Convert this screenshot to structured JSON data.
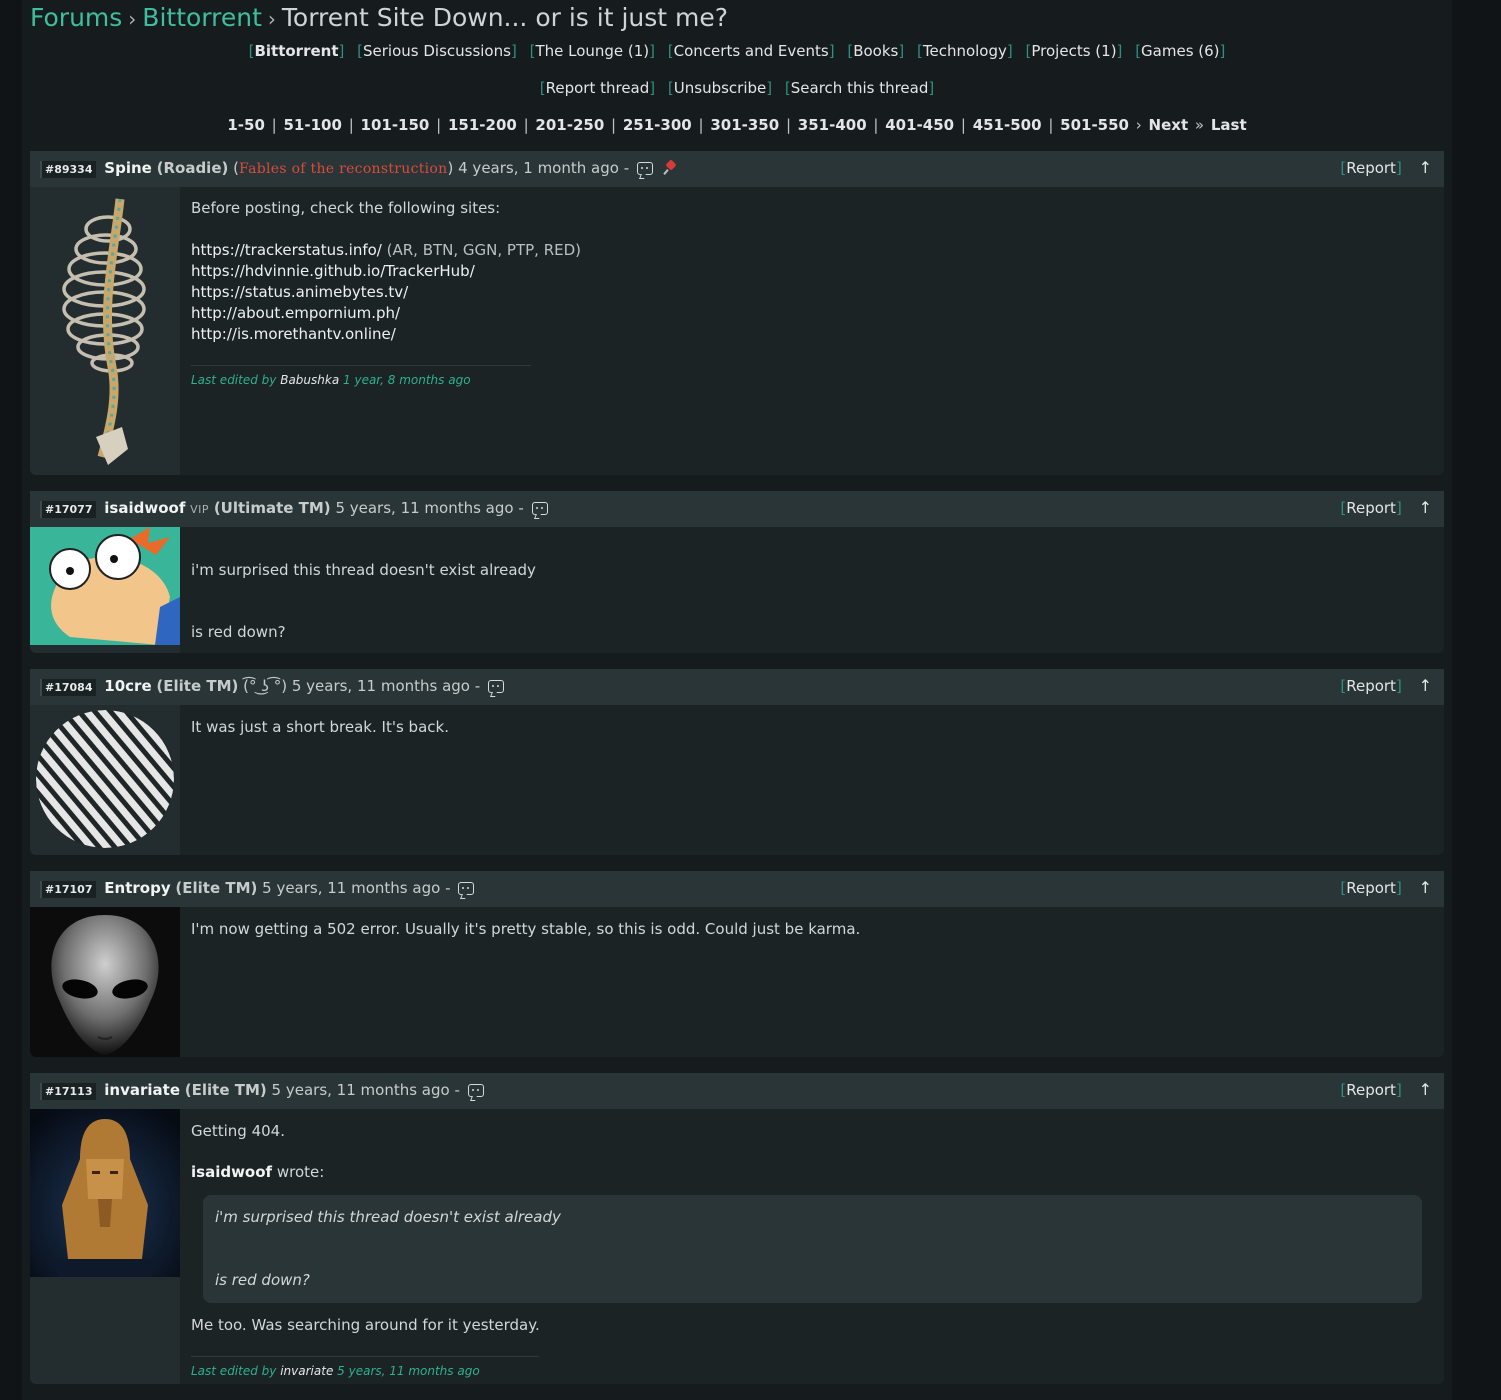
{
  "breadcrumb": {
    "forums": "Forums",
    "category": "Bittorrent",
    "thread_title": "Torrent Site Down... or is it just me?"
  },
  "categories": [
    {
      "label": "Bittorrent",
      "active": true
    },
    {
      "label": "Serious Discussions"
    },
    {
      "label": "The Lounge (1)"
    },
    {
      "label": "Concerts and Events"
    },
    {
      "label": "Books"
    },
    {
      "label": "Technology"
    },
    {
      "label": "Projects (1)"
    },
    {
      "label": "Games (6)"
    }
  ],
  "thread_actions": {
    "report": "Report thread",
    "unsubscribe": "Unsubscribe",
    "search": "Search this thread"
  },
  "pagination": {
    "pages": [
      "1-50",
      "51-100",
      "101-150",
      "151-200",
      "201-250",
      "251-300",
      "301-350",
      "351-400",
      "401-450",
      "451-500",
      "501-550"
    ],
    "next": "Next",
    "last": "Last"
  },
  "report_label": "Report",
  "up_arrow": "↑",
  "posts": [
    {
      "id": "#89334",
      "user": "Spine",
      "rank": "(Roadie)",
      "title": "Fables of the reconstruction",
      "time": "4 years, 1 month ago",
      "avatar": "skeleton-spine",
      "intro": "Before posting, check the following sites:",
      "links": [
        {
          "url": "https://trackerstatus.info/",
          "note": "(AR, BTN, GGN, PTP, RED)"
        },
        {
          "url": "https://hdvinnie.github.io/TrackerHub/",
          "note": ""
        },
        {
          "url": "https://status.animebytes.tv/",
          "note": ""
        },
        {
          "url": "http://about.empornium.ph/",
          "note": ""
        },
        {
          "url": "http://is.morethantv.online/",
          "note": ""
        }
      ],
      "edited": {
        "prefix": "Last edited by",
        "by": "Babushka",
        "when": "1 year, 8 months ago"
      }
    },
    {
      "id": "#17077",
      "user": "isaidwoof",
      "badge": "VIP",
      "rank": "(Ultimate TM)",
      "time": "5 years, 11 months ago",
      "lines": [
        "i'm surprised this thread doesn't exist already",
        "is red down?"
      ]
    },
    {
      "id": "#17084",
      "user": "10cre",
      "rank": "(Elite TM)",
      "title": "(͡° ͜ʖ ͡°)",
      "time": "5 years, 11 months ago",
      "text": "It was just a short break. It's back."
    },
    {
      "id": "#17107",
      "user": "Entropy",
      "rank": "(Elite TM)",
      "time": "5 years, 11 months ago",
      "text": "I'm now getting a 502 error. Usually it's pretty stable, so this is odd. Could just be karma."
    },
    {
      "id": "#17113",
      "user": "invariate",
      "rank": "(Elite TM)",
      "time": "5 years, 11 months ago",
      "text1": "Getting 404.",
      "quote_author": "isaidwoof",
      "quote_wrote": "wrote:",
      "quote_lines": [
        "i'm surprised this thread doesn't exist already",
        "is red down?"
      ],
      "text2": "Me too. Was searching around for it yesterday.",
      "edited": {
        "prefix": "Last edited by",
        "by": "invariate",
        "when": "5 years, 11 months ago"
      }
    }
  ]
}
